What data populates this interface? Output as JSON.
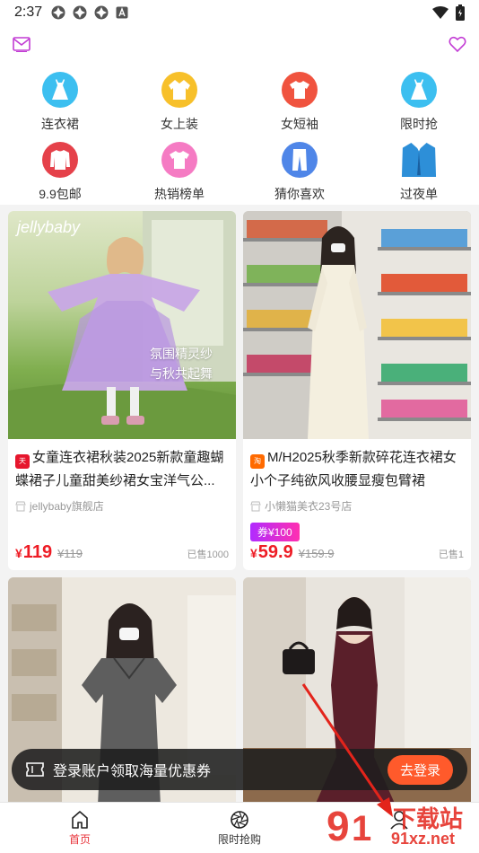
{
  "status_bar": {
    "time": "2:37",
    "notification_icons": [
      "target-icon",
      "target-icon",
      "target-icon",
      "a-icon"
    ],
    "system_icons": [
      "wifi-icon",
      "battery-icon"
    ]
  },
  "top_bar": {
    "icons": [
      "mail-icon",
      "heart-icon"
    ],
    "accent_color": "#c23bd4"
  },
  "categories": [
    {
      "label": "连衣裙",
      "icon": "dress-icon",
      "color": "#3cbff0"
    },
    {
      "label": "女上装",
      "icon": "blouse-icon",
      "color": "#f7c02a"
    },
    {
      "label": "女短袖",
      "icon": "tshirt-icon",
      "color": "#f0533f"
    },
    {
      "label": "限时抢",
      "icon": "dress-icon",
      "color": "#3cbff0"
    },
    {
      "label": "9.9包邮",
      "icon": "sweater-icon",
      "color": "#e5414a"
    },
    {
      "label": "热销榜单",
      "icon": "tshirt-icon",
      "color": "#f57bc3"
    },
    {
      "label": "猜你喜欢",
      "icon": "pants-icon",
      "color": "#4f86e8"
    },
    {
      "label": "过夜单",
      "icon": "suit-icon",
      "color": "#2d8fd8"
    }
  ],
  "products": [
    {
      "image_text_brand": "jellybaby",
      "image_text_overlay_1": "氛围精灵纱",
      "image_text_overlay_2": "与秋共起舞",
      "platform_badge": "tmall-badge-icon",
      "title": "女童连衣裙秋装2025新款童趣蝴蝶裙子儿童甜美纱裙女宝洋气公...",
      "shop": "jellybaby旗舰店",
      "price_symbol": "¥",
      "price": "119",
      "original_price": "¥119",
      "sold": "已售1000"
    },
    {
      "platform_badge": "taobao-badge-icon",
      "title": "M/H2025秋季新款碎花连衣裙女小个子纯欲风收腰显瘦包臂裙",
      "shop": "小懒猫美衣23号店",
      "coupon": "券¥100",
      "price_symbol": "¥",
      "price": "59.9",
      "original_price": "¥159.9",
      "sold": "已售1"
    },
    {
      "title": "",
      "shop": ""
    },
    {
      "title": "",
      "shop": ""
    }
  ],
  "toast": {
    "icon": "ticket-icon",
    "text": "登录账户领取海量优惠券",
    "button": "去登录"
  },
  "tab_bar": {
    "tabs": [
      {
        "label": "首页",
        "icon": "home-icon",
        "active": true
      },
      {
        "label": "限时抢购",
        "icon": "aperture-icon",
        "active": false
      },
      {
        "label": "",
        "icon": "user-icon",
        "active": false
      }
    ],
    "active_color": "#e8333a"
  },
  "watermark": {
    "text_top": "下载站",
    "text_bottom": "91xz.net"
  }
}
